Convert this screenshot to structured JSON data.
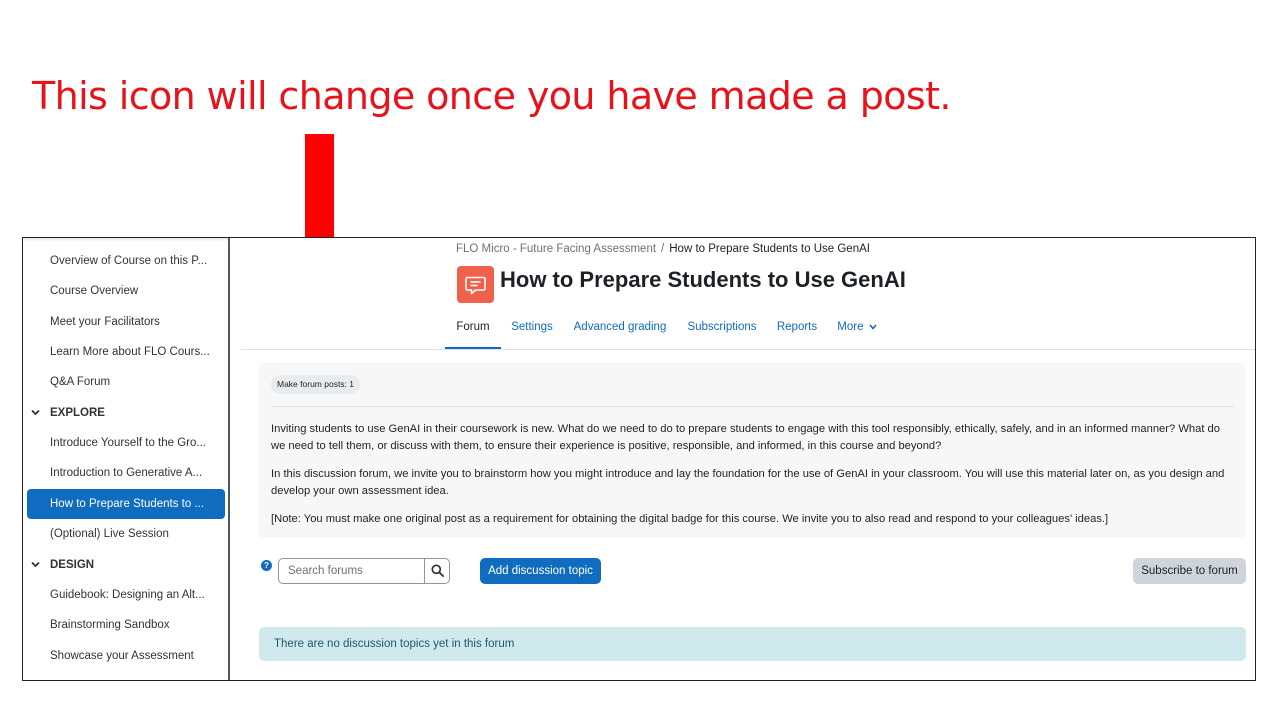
{
  "annotation": {
    "text": "This icon will change once you have made a post.",
    "color": "#e8121b"
  },
  "sidebar": {
    "items": [
      {
        "label": "Overview of Course on this P..."
      },
      {
        "label": "Course Overview"
      },
      {
        "label": "Meet your Facilitators"
      },
      {
        "label": "Learn More about FLO Cours..."
      },
      {
        "label": "Q&A Forum"
      },
      {
        "label": "EXPLORE",
        "section": true
      },
      {
        "label": "Introduce Yourself to the Gro..."
      },
      {
        "label": "Introduction to Generative A..."
      },
      {
        "label": "How to Prepare Students to ...",
        "active": true
      },
      {
        "label": "(Optional) Live Session"
      },
      {
        "label": "DESIGN",
        "section": true
      },
      {
        "label": "Guidebook: Designing an Alt..."
      },
      {
        "label": "Brainstorming Sandbox"
      },
      {
        "label": "Showcase your Assessment"
      }
    ]
  },
  "breadcrumb": {
    "course": "FLO Micro - Future Facing Assessment",
    "separator": "/",
    "current": "How to Prepare Students to Use GenAI"
  },
  "page": {
    "title": "How to Prepare Students to Use GenAI",
    "icon": "forum-icon",
    "accent": "#f0614b"
  },
  "tabs": [
    {
      "label": "Forum",
      "active": true
    },
    {
      "label": "Settings"
    },
    {
      "label": "Advanced grading"
    },
    {
      "label": "Subscriptions"
    },
    {
      "label": "Reports"
    },
    {
      "label": "More"
    }
  ],
  "completion": {
    "label": "Make forum posts: 1"
  },
  "description": {
    "paragraphs": [
      "Inviting students to use GenAI in their coursework is new. What do we need to do to prepare students to engage with this tool responsibly, ethically, safely, and in an informed manner? What do we need to tell them, or discuss with them, to ensure their experience is positive, responsible, and informed, in this course and beyond?",
      "In this discussion forum, we invite you to brainstorm how you might introduce and lay the foundation for the use of GenAI in your classroom. You will use this material later on, as you design and develop your own assessment idea.",
      "[Note: You must make one original post as a requirement for obtaining the digital badge for this course. We invite you to also read and respond to your colleagues' ideas.]"
    ]
  },
  "controls": {
    "help_icon": "question-circle-icon",
    "search_placeholder": "Search forums",
    "search_icon": "search-icon",
    "add_button": "Add discussion topic",
    "subscribe_button": "Subscribe to forum"
  },
  "alert": {
    "text": "There are no discussion topics yet in this forum"
  },
  "colors": {
    "primary": "#0f6cbf",
    "alert_bg": "#cfe9ec"
  }
}
